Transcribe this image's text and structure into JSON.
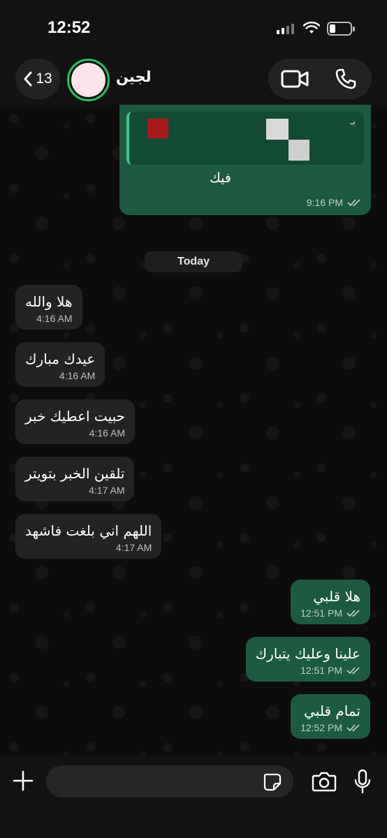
{
  "status_bar": {
    "time": "12:52"
  },
  "header": {
    "back_count": "13",
    "contact_name": "لجين"
  },
  "top_message": {
    "quote_header": "بـ",
    "text": "فيك",
    "time": "9:16 PM"
  },
  "date_separator": "Today",
  "messages": [
    {
      "direction": "in",
      "text": "هلا والله",
      "time": "4:16 AM"
    },
    {
      "direction": "in",
      "text": "عيدك مبارك",
      "time": "4:16 AM"
    },
    {
      "direction": "in",
      "text": "حبيت اعطيك خبر",
      "time": "4:16 AM"
    },
    {
      "direction": "in",
      "text": "تلقين الخبر بتويتر",
      "time": "4:17 AM"
    },
    {
      "direction": "in",
      "text": "اللهم اني بلغت فاشهد",
      "time": "4:17 AM"
    },
    {
      "direction": "out",
      "text": "هلا قلبي",
      "time": "12:51 PM"
    },
    {
      "direction": "out",
      "text": "علينا وعليك يتبارك",
      "time": "12:51 PM"
    },
    {
      "direction": "out",
      "text": "تمام قلبي",
      "time": "12:52 PM"
    }
  ],
  "input": {
    "placeholder": ""
  },
  "colors": {
    "incoming_bubble": "#232323",
    "outgoing_bubble": "#1d5a41",
    "avatar_ring": "#25c25a"
  },
  "icons": {
    "back": "chevron-left-icon",
    "video": "video-camera-icon",
    "phone": "phone-icon",
    "plus": "plus-icon",
    "sticker": "sticker-icon",
    "camera": "camera-icon",
    "mic": "microphone-icon"
  }
}
